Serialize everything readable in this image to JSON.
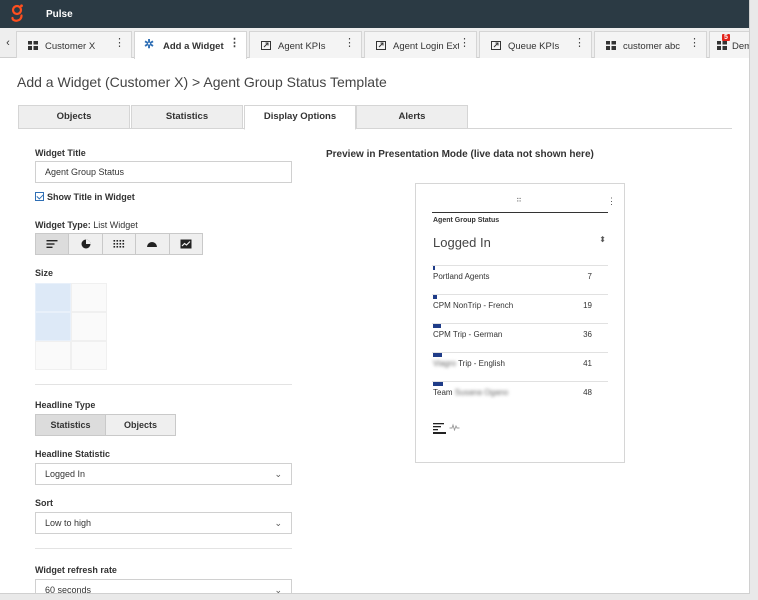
{
  "app": {
    "title": "Pulse",
    "brand_color": "#ff4f1f"
  },
  "tabs": [
    {
      "label": "Customer X",
      "icon": "grid-icon"
    },
    {
      "label": "Add a Widget",
      "icon": "gear-icon"
    },
    {
      "label": "Agent KPIs",
      "icon": "external-window-icon"
    },
    {
      "label": "Agent Login Exter",
      "icon": "external-window-icon"
    },
    {
      "label": "Queue KPIs",
      "icon": "external-window-icon"
    },
    {
      "label": "customer abc",
      "icon": "grid-icon"
    },
    {
      "label": "Dem",
      "icon": "grid-icon",
      "badge": "5"
    }
  ],
  "page": {
    "title": "Add a Widget (Customer X) > Agent Group Status Template"
  },
  "subtabs": [
    "Objects",
    "Statistics",
    "Display Options",
    "Alerts"
  ],
  "form": {
    "widget_title_label": "Widget Title",
    "widget_title_value": "Agent Group Status",
    "show_title_label": "Show Title in Widget",
    "widget_type_label": "Widget Type:",
    "widget_type_value": "List Widget",
    "size_label": "Size",
    "headline_type_label": "Headline Type",
    "headline_options": [
      "Statistics",
      "Objects"
    ],
    "headline_statistic_label": "Headline Statistic",
    "headline_statistic_value": "Logged In",
    "sort_label": "Sort",
    "sort_value": "Low to high",
    "refresh_label": "Widget refresh rate",
    "refresh_value": "60 seconds"
  },
  "preview": {
    "label": "Preview in Presentation Mode (live data not shown here)",
    "card_title": "Agent Group Status",
    "statistic": "Logged In",
    "rows": [
      {
        "name": "Portland Agents",
        "value": "7",
        "level": 7
      },
      {
        "name": "CPM NonTrip - French",
        "value": "19",
        "level": 19
      },
      {
        "name": "CPM Trip - German",
        "value": "36",
        "level": 36
      },
      {
        "name_blurred": "Viagro",
        "name": " Trip - English",
        "value": "41",
        "level": 41
      },
      {
        "name": "Team ",
        "name_blurred": "Susana Ogano",
        "value": "48",
        "level": 48
      }
    ],
    "bar_color": "#1f3c88"
  }
}
